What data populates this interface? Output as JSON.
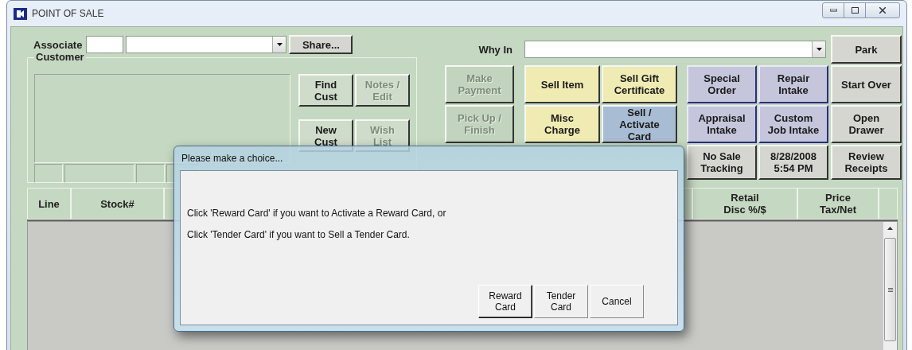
{
  "window": {
    "title": "POINT OF SALE"
  },
  "associate": {
    "label": "Associate",
    "share_button": "Share..."
  },
  "customer": {
    "title": "Customer",
    "buttons": [
      {
        "label": "Find\nCust",
        "disabled": false
      },
      {
        "label": "Notes /\nEdit",
        "disabled": true
      },
      {
        "label": "New\nCust",
        "disabled": false
      },
      {
        "label": "Wish\nList",
        "disabled": true
      }
    ]
  },
  "why_in": {
    "label": "Why In"
  },
  "action_columns": [
    [
      {
        "label": "Make\nPayment",
        "disabled": true,
        "color": "#c2d4be"
      },
      {
        "label": "Pick Up /\nFinish",
        "disabled": true,
        "color": "#c2d4be"
      }
    ],
    [
      {
        "label": "Sell Item",
        "disabled": false,
        "color": "#efebb3"
      },
      {
        "label": "Misc\nCharge",
        "disabled": false,
        "color": "#efebb3"
      }
    ],
    [
      {
        "label": "Sell Gift\nCertificate",
        "disabled": false,
        "color": "#efebb3"
      },
      {
        "label": "Sell /\nActivate\nCard",
        "disabled": false,
        "color": "#a8bcd4"
      }
    ],
    [
      {
        "label": "Special\nOrder",
        "disabled": false,
        "color": "#c5c6dc"
      },
      {
        "label": "Appraisal\nIntake",
        "disabled": false,
        "color": "#c5c6dc"
      },
      {
        "label": "No Sale\nTracking",
        "disabled": false,
        "color": "#d6d6d0"
      }
    ],
    [
      {
        "label": "Repair\nIntake",
        "disabled": false,
        "color": "#c5c6dc"
      },
      {
        "label": "Custom\nJob Intake",
        "disabled": false,
        "color": "#c5c6dc"
      },
      {
        "label": "8/28/2008\n5:54 PM",
        "disabled": false,
        "color": "#d6d6d0"
      }
    ]
  ],
  "side_buttons": [
    {
      "label": "Park"
    },
    {
      "label": "Start Over"
    },
    {
      "label": "Open\nDrawer"
    },
    {
      "label": "Review\nReceipts"
    }
  ],
  "table": {
    "columns": [
      {
        "label": "Line"
      },
      {
        "label": "Stock#"
      },
      {
        "label": "Retail\nDisc %/$"
      },
      {
        "label": "Price\nTax/Net"
      }
    ]
  },
  "dialog": {
    "title": "Please make a choice...",
    "lines": [
      "Click 'Reward Card' if you want to Activate a Reward Card, or",
      "Click 'Tender Card' if you want to Sell a Tender Card."
    ],
    "buttons": [
      {
        "label": "Reward\nCard",
        "focused": true
      },
      {
        "label": "Tender\nCard",
        "focused": false
      },
      {
        "label": "Cancel",
        "focused": false
      }
    ]
  }
}
